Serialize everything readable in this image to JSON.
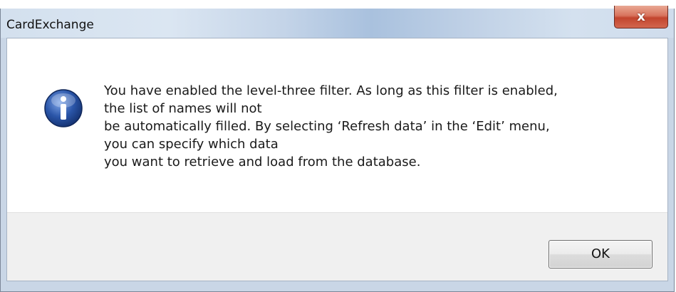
{
  "dialog": {
    "title": "CardExchange",
    "close_glyph": "x",
    "icon": "info-icon",
    "message_lines": [
      "You have enabled the level-three filter. As long as this filter is enabled,",
      "the list of names will not",
      "be automatically filled. By selecting ‘Refresh data’ in the ‘Edit’ menu,",
      "you can specify which data",
      "you want to retrieve and load from the database."
    ],
    "ok_label": "OK"
  },
  "colors": {
    "close_button": "#c2452e",
    "info_icon_blue": "#2a55a8",
    "button_bar": "#f0f0f0"
  }
}
